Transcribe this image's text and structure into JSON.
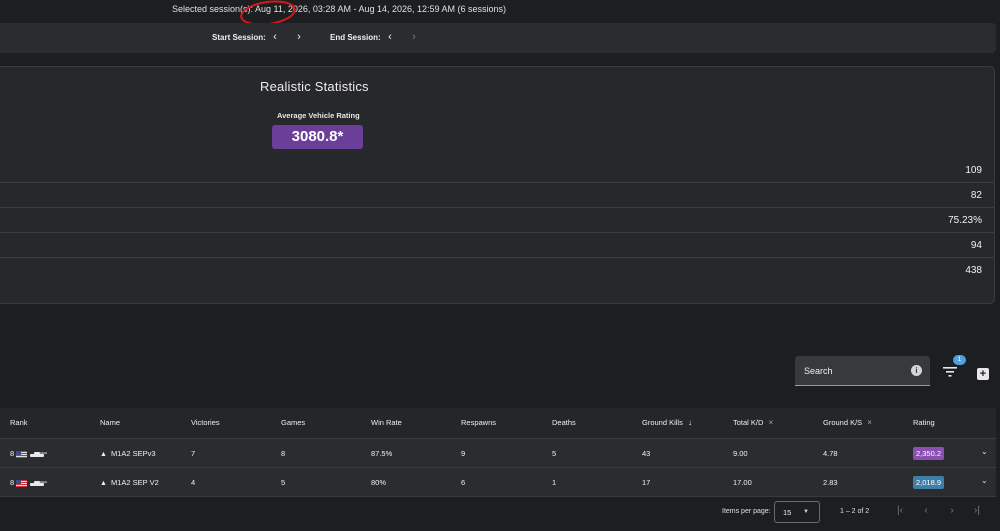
{
  "header": {
    "session_text": "Selected session(s): Aug 11, 2026, 03:28 AM - Aug 14, 2026, 12:59 AM (6 sessions)"
  },
  "session_nav": {
    "start_label": "Start Session:",
    "end_label": "End Session:",
    "prev_glyph": "‹",
    "next_glyph": "›"
  },
  "stats": {
    "title": "Realistic Statistics",
    "avg_label": "Average Vehicle Rating",
    "avg_value": "3080.8*",
    "rows": [
      "109",
      "82",
      "75.23%",
      "94",
      "438"
    ]
  },
  "toolbar": {
    "search_label": "Search",
    "info_glyph": "i",
    "filter_count": "1",
    "add_glyph": "+"
  },
  "table": {
    "headers": {
      "rank": "Rank",
      "name": "Name",
      "victories": "Victories",
      "games": "Games",
      "win_rate": "Win Rate",
      "respawns": "Respawns",
      "deaths": "Deaths",
      "ground_kills": "Ground Kills",
      "total_kd": "Total K/D",
      "ground_ks": "Ground K/S",
      "rating": "Rating"
    },
    "sort_arrow": "↓",
    "clear_glyph": "×",
    "rows": [
      {
        "rank": "8",
        "name": "M1A2 SEPv3",
        "victories": "7",
        "games": "8",
        "win_rate": "87.5%",
        "respawns": "9",
        "deaths": "5",
        "ground_kills": "43",
        "total_kd": "9.00",
        "ground_ks": "4.78",
        "rating": "2,350.2"
      },
      {
        "rank": "8",
        "name": "M1A2 SEP V2",
        "victories": "4",
        "games": "5",
        "win_rate": "80%",
        "respawns": "6",
        "deaths": "1",
        "ground_kills": "17",
        "total_kd": "17.00",
        "ground_ks": "2.83",
        "rating": "2,018.9"
      }
    ],
    "expand_glyph": "⌄"
  },
  "pager": {
    "items_label": "Items per page:",
    "page_size": "15",
    "range": "1 – 2 of 2"
  },
  "colors": {
    "accent_purple": "#6b3f99",
    "rating_purple": "#8b4fb3",
    "rating_blue": "#3f7fa6",
    "badge_blue": "#4ea1e0",
    "annotation_red": "#d21a1a"
  }
}
